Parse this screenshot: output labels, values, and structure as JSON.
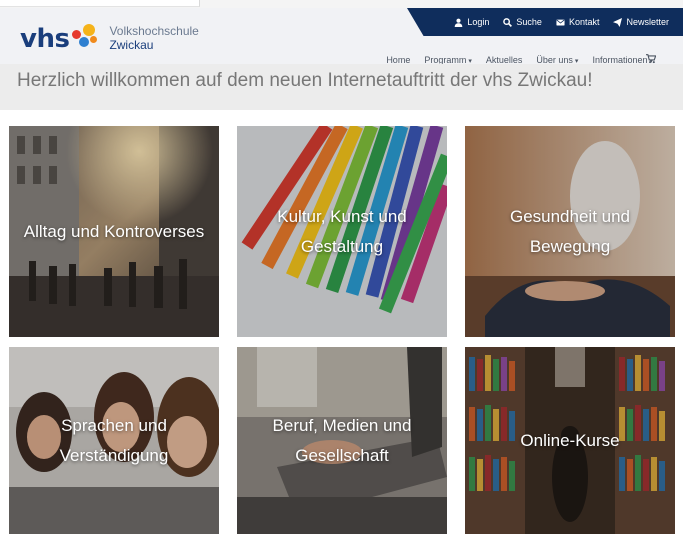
{
  "logo": {
    "wordmark": "vhs",
    "line1": "Volkshochschule",
    "line2": "Zwickau"
  },
  "utility_nav": [
    {
      "label": "Login",
      "icon": "user-icon"
    },
    {
      "label": "Suche",
      "icon": "search-icon"
    },
    {
      "label": "Kontakt",
      "icon": "envelope-icon"
    },
    {
      "label": "Newsletter",
      "icon": "paper-plane-icon"
    }
  ],
  "main_nav": [
    {
      "label": "Home",
      "dropdown": false
    },
    {
      "label": "Programm",
      "dropdown": true
    },
    {
      "label": "Aktuelles",
      "dropdown": false
    },
    {
      "label": "Über uns",
      "dropdown": true
    },
    {
      "label": "Informationen",
      "dropdown": true
    }
  ],
  "cart_icon": "shopping-cart-icon",
  "welcome": {
    "title": "Herzlich willkommen auf dem neuen Internetauftritt der vhs Zwickau!"
  },
  "tiles": [
    {
      "label": "Alltag und Kontroverses",
      "image": "city-street-crowd"
    },
    {
      "label": "Kultur, Kunst und\nGestaltung",
      "image": "colored-pencils"
    },
    {
      "label": "Gesundheit und\nBewegung",
      "image": "yoga-meditation"
    },
    {
      "label": "Sprachen und\nVerständigung",
      "image": "students-learning"
    },
    {
      "label": "Beruf, Medien und\nGesellschaft",
      "image": "laptop-typing"
    },
    {
      "label": "Online-Kurse",
      "image": "library-bookshelves"
    }
  ],
  "colors": {
    "brand_navy": "#1a3e7c",
    "util_bar": "#0f2d5c",
    "dot_red": "#e63a2e",
    "dot_yellow": "#f5b31a",
    "dot_blue": "#2e7fd0"
  }
}
